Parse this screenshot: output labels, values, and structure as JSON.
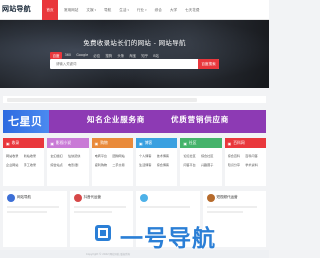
{
  "logo": "网站导航",
  "nav": [
    "首页",
    "常用网站",
    "文娱",
    "导航",
    "生活",
    "行业",
    "综合",
    "大学",
    "七天花费"
  ],
  "nav_has_dropdown": [
    false,
    false,
    true,
    false,
    true,
    true,
    false,
    false,
    false
  ],
  "hero": {
    "title": "免费收录站长们的网站 - 网站导航",
    "tabs": [
      "百度",
      "360",
      "Google",
      "必应",
      "搜狗",
      "头条",
      "淘宝",
      "知乎",
      "B站"
    ],
    "search_placeholder": "请输入关键词",
    "search_button": "百度搜索"
  },
  "banner": {
    "brand": "七星贝",
    "text1": "知名企业服务商",
    "text2": "优质营销供应商"
  },
  "categories": [
    {
      "title": "收录",
      "icon": "folder-icon",
      "color": "#e9373c",
      "links": [
        "网站收录",
        "新站收录",
        "企业网站",
        "手工收录"
      ]
    },
    {
      "title": "影视小说",
      "icon": "folder-icon",
      "color": "#c97ad6",
      "links": [
        "玄幻魔幻",
        "仙侠武侠",
        "综合站点",
        "电影/剧"
      ]
    },
    {
      "title": "购物",
      "icon": "folder-icon",
      "color": "#e98a3a",
      "links": [
        "电商平台",
        "团购网站",
        "返利购物",
        "二手交易"
      ]
    },
    {
      "title": "博客",
      "icon": "folder-icon",
      "color": "#3aa0e0",
      "links": [
        "个人博客",
        "技术博客",
        "生活博客",
        "综合博客"
      ]
    },
    {
      "title": "社区",
      "icon": "folder-icon",
      "color": "#45b36b",
      "links": [
        "论坛社区",
        "综合社区",
        "问答平台",
        "兴趣圈子"
      ]
    },
    {
      "title": "百科网",
      "icon": "folder-icon",
      "color": "#e9373c",
      "links": [
        "综合百科",
        "百科问答",
        "知识分享",
        "学术资料"
      ]
    }
  ],
  "lower_cards": [
    {
      "title": "网站导航",
      "thumb": "#3d6fd6"
    },
    {
      "title": "抖音代运营",
      "thumb": "#d64848"
    },
    {
      "title": "",
      "thumb": "#4db1e8"
    },
    {
      "title": "短视频代运营",
      "thumb": "#b66b2c"
    }
  ],
  "watermark": "一号导航",
  "footer": "Copyright © 2022 网站导航 版权所有"
}
